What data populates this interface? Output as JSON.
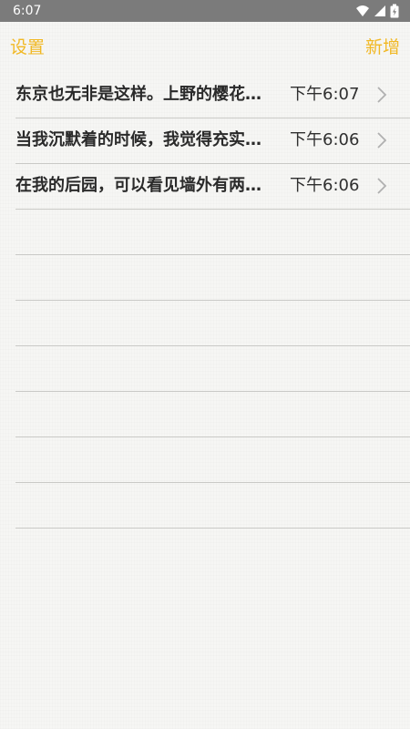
{
  "status_bar": {
    "time": "6:07",
    "icons": [
      "wifi-icon",
      "cellular-signal-icon",
      "battery-charging-icon"
    ]
  },
  "nav": {
    "left_label": "设置",
    "right_label": "新增",
    "accent_color": "#f1b824"
  },
  "notes": [
    {
      "title": "东京也无非是这样。上野的樱花烂熳的时节",
      "time": "下午6:07"
    },
    {
      "title": "当我沉默着的时候，我觉得充实；我将开口",
      "time": "下午6:06"
    },
    {
      "title": "在我的后园，可以看见墙外有两株树",
      "time": "下午6:06"
    }
  ],
  "empty_lines": 7
}
